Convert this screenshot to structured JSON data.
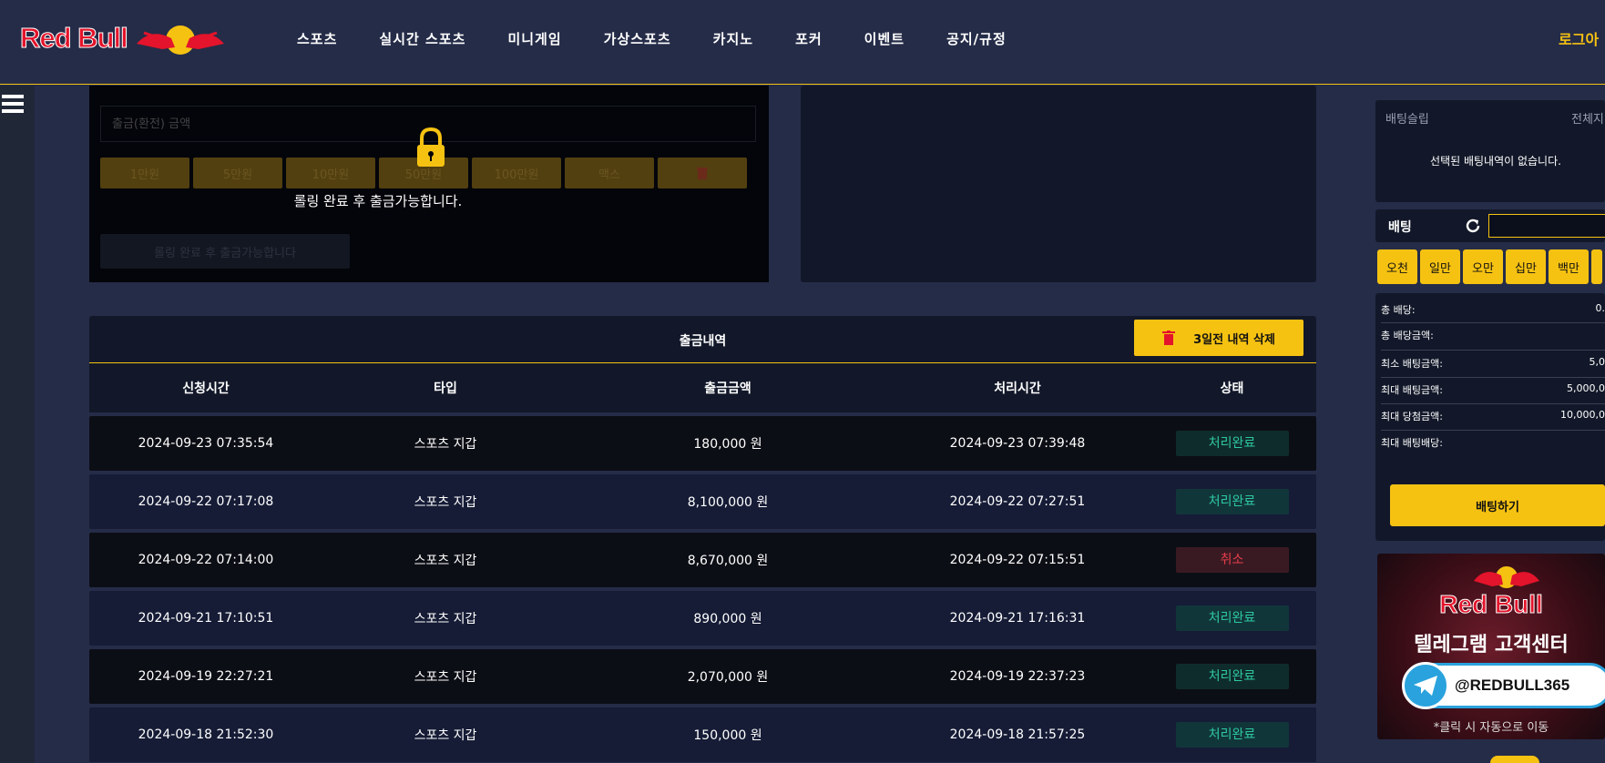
{
  "header": {
    "logo_text": "Red Bull",
    "nav": [
      "스포츠",
      "실시간 스포츠",
      "미니게임",
      "가상스포츠",
      "카지노",
      "포커",
      "이벤트",
      "공지/규정"
    ],
    "login_label": "로그아"
  },
  "withdraw": {
    "input_placeholder": "출금(환전) 금액",
    "quick_amounts": [
      "1만원",
      "5만원",
      "10만원",
      "50만원",
      "100만원",
      "맥스"
    ],
    "submit_label": "롤링 완료 후 출금가능합니다",
    "lock_message": "롤링 완료 후 출금가능합니다."
  },
  "history": {
    "title": "출금내역",
    "delete_label": "3일전 내역 삭제",
    "columns": [
      "신청시간",
      "타입",
      "출금금액",
      "처리시간",
      "상태"
    ],
    "rows": [
      {
        "requested": "2024-09-23 07:35:54",
        "type": "스포츠 지갑",
        "amount": "180,000 원",
        "processed": "2024-09-23 07:39:48",
        "status": "처리완료",
        "state": "done"
      },
      {
        "requested": "2024-09-22 07:17:08",
        "type": "스포츠 지갑",
        "amount": "8,100,000 원",
        "processed": "2024-09-22 07:27:51",
        "status": "처리완료",
        "state": "done"
      },
      {
        "requested": "2024-09-22 07:14:00",
        "type": "스포츠 지갑",
        "amount": "8,670,000 원",
        "processed": "2024-09-22 07:15:51",
        "status": "취소",
        "state": "cancel"
      },
      {
        "requested": "2024-09-21 17:10:51",
        "type": "스포츠 지갑",
        "amount": "890,000 원",
        "processed": "2024-09-21 17:16:31",
        "status": "처리완료",
        "state": "done"
      },
      {
        "requested": "2024-09-19 22:27:21",
        "type": "스포츠 지갑",
        "amount": "2,070,000 원",
        "processed": "2024-09-19 22:37:23",
        "status": "처리완료",
        "state": "done"
      },
      {
        "requested": "2024-09-18 21:52:30",
        "type": "스포츠 지갑",
        "amount": "150,000 원",
        "processed": "2024-09-18 21:57:25",
        "status": "처리완료",
        "state": "done"
      }
    ]
  },
  "betslip": {
    "title": "배팅슬립",
    "all_label": "전체지",
    "empty_message": "선택된 배팅내역이 없습니다.",
    "bet_label": "배팅",
    "amount_buttons": [
      "오천",
      "일만",
      "오만",
      "십만",
      "백만"
    ],
    "info": [
      {
        "label": "총 배당:",
        "value": "0."
      },
      {
        "label": "총 배당금액:",
        "value": ""
      },
      {
        "label": "최소 배팅금액:",
        "value": "5,0"
      },
      {
        "label": "최대 배팅금액:",
        "value": "5,000,0"
      },
      {
        "label": "최대 당첨금액:",
        "value": "10,000,0"
      },
      {
        "label": "최대 배팅배당:",
        "value": ""
      }
    ],
    "bet_button": "배팅하기"
  },
  "banner": {
    "brand": "Red Bull",
    "title": "텔레그램 고객센터",
    "handle": "@REDBULL365",
    "note": "*클릭 시 자동으로 이동"
  },
  "colors": {
    "accent": "#f6c212",
    "background": "#252c48",
    "panel": "#121829",
    "done": "#2ec8a0",
    "cancel": "#e83d4b"
  }
}
